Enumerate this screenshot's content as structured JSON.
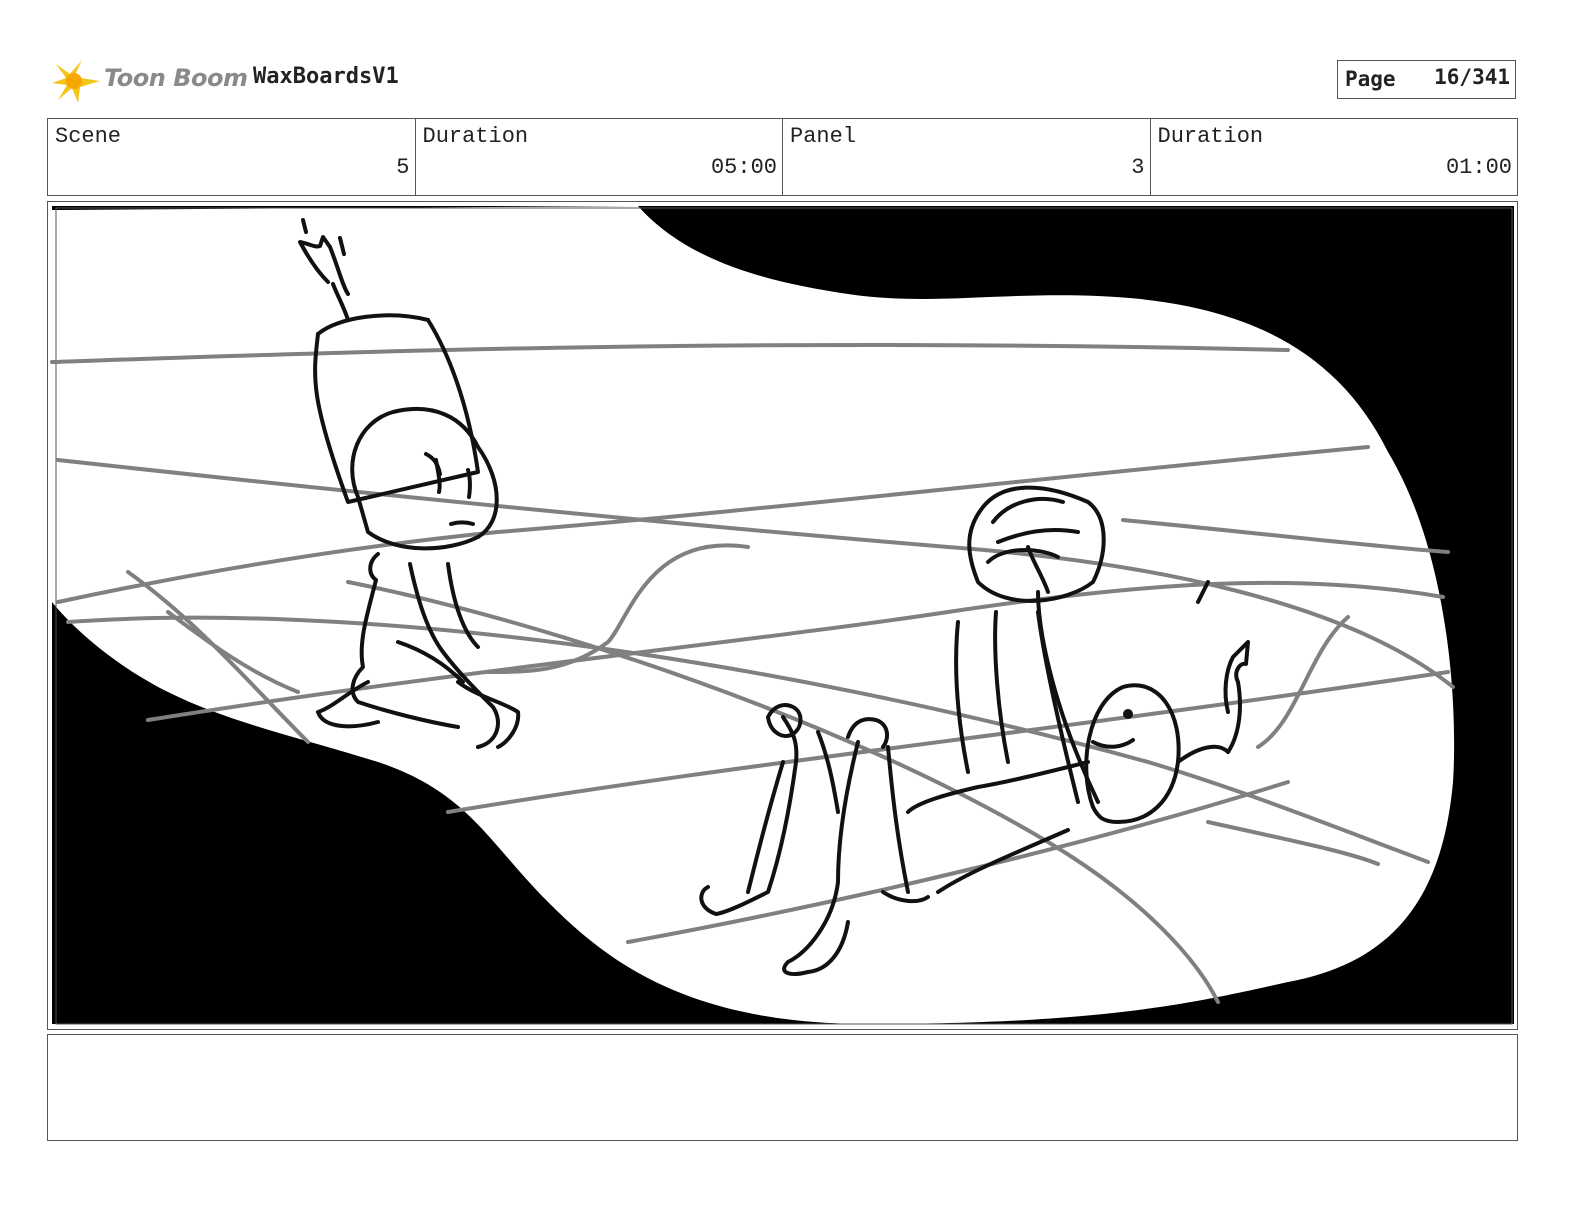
{
  "header": {
    "logo_text": "Toon Boom",
    "project_title": "WaxBoardsV1",
    "page_label": "Page",
    "page_value": "16/341"
  },
  "info": {
    "scene_label": "Scene",
    "scene_value": "5",
    "scene_duration_label": "Duration",
    "scene_duration_value": "05:00",
    "panel_label": "Panel",
    "panel_value": "3",
    "panel_duration_label": "Duration",
    "panel_duration_value": "01:00"
  },
  "colors": {
    "logo_accent": "#f5c518",
    "sketch_line": "#111111",
    "grid_line": "#808080",
    "vignette": "#000000"
  },
  "notes": ""
}
